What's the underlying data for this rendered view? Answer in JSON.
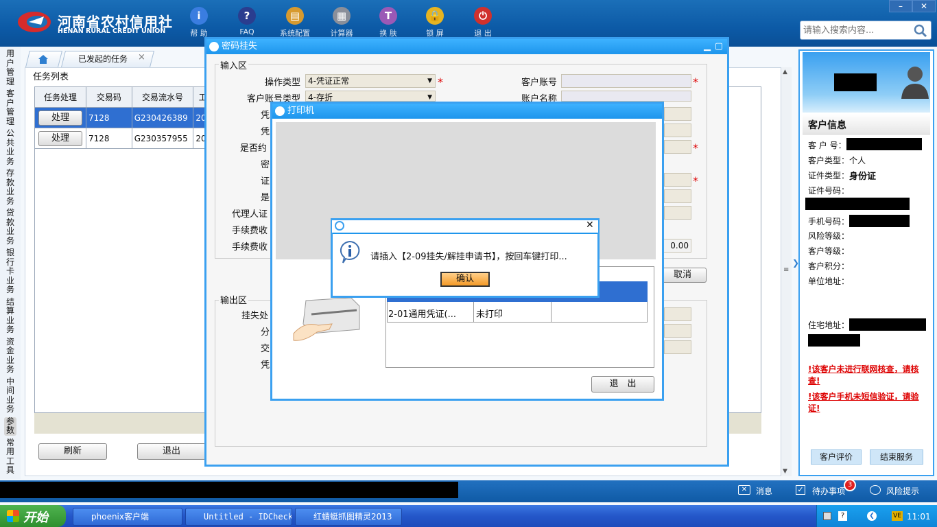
{
  "app": {
    "logo_cn": "河南省农村信用社",
    "logo_en": "HENAN RURAL CREDIT UNION",
    "nav": [
      {
        "label": "帮 助",
        "icon": "info-icon",
        "color": "#3a7de0"
      },
      {
        "label": "FAQ",
        "icon": "question-icon",
        "color": "#2a3d8f"
      },
      {
        "label": "系统配置",
        "icon": "toolbox-icon",
        "color": "#d79a2f"
      },
      {
        "label": "计算器",
        "icon": "calculator-icon",
        "color": "#8a8f9a"
      },
      {
        "label": "换 肤",
        "icon": "shirt-icon",
        "color": "#9b59b6"
      },
      {
        "label": "锁 屏",
        "icon": "lock-icon",
        "color": "#e6b422"
      },
      {
        "label": "退 出",
        "icon": "power-icon",
        "color": "#d0312d"
      }
    ],
    "search_placeholder": "请输入搜索内容...",
    "win_min": "–",
    "win_close": "✕"
  },
  "left_tabs": [
    "用户管理",
    "客户管理",
    "公共业务",
    "存款业务",
    "贷款业务",
    "银行卡业务",
    "结算业务",
    "资金业务",
    "中间业务",
    "参数",
    "常用工具"
  ],
  "tabs": {
    "home_icon": "home-icon",
    "active": "已发起的任务",
    "close": "×"
  },
  "task": {
    "title": "任务列表",
    "headers": [
      "任务处理",
      "交易码",
      "交易流水号",
      "工"
    ],
    "rows": [
      {
        "action": "处理",
        "code": "7128",
        "serial": "G230426389",
        "extra": "20"
      },
      {
        "action": "处理",
        "code": "7128",
        "serial": "G230357955",
        "extra": "20"
      }
    ],
    "refresh": "刷新",
    "exit": "退出"
  },
  "pwd_dialog": {
    "title": "密码挂失",
    "input_area": "输入区",
    "output_area": "输出区",
    "op_type_label": "操作类型",
    "op_type_value": "4-凭证正常",
    "acct_type_label": "客户账号类型",
    "acct_type_value": "4-存折",
    "cust_acct_label": "客户账号",
    "acct_name_label": "账户名称",
    "partial_labels": [
      "凭",
      "凭",
      "是否约",
      "密",
      "证",
      "是",
      "代理人证",
      "手续费收",
      "手续费收"
    ],
    "output_labels": [
      "挂失处",
      "分",
      "交",
      "凭"
    ],
    "fee_value": "0.00",
    "cancel": "取消"
  },
  "printer_dialog": {
    "title": "打印机",
    "table_row": [
      "2-01通用凭证(...",
      "未打印",
      ""
    ],
    "exit": "退　出"
  },
  "msgbox": {
    "message": "请插入【2-09挂失/解挂申请书】，按回车键打印...",
    "ok": "确认",
    "close": "✕"
  },
  "customer": {
    "title": "客户信息",
    "labels": {
      "no": "客 户 号：",
      "type": "客户类型：",
      "idtype": "证件类型：",
      "idno": "证件号码：",
      "phone": "手机号码：",
      "risk": "风险等级：",
      "level": "客户等级：",
      "points": "客户积分：",
      "work": "单位地址：",
      "home": "住宅地址："
    },
    "type_value": "个人",
    "idtype_value": "身份证",
    "warn1": "该客户未进行联网核查，请核查!",
    "warn2": "该客户手机未短信验证，请验证!",
    "eval_btn": "客户评价",
    "end_btn": "结束服务"
  },
  "bottombar": {
    "msg": "消息",
    "todo": "待办事项",
    "todo_count": "3",
    "risk": "风险提示"
  },
  "taskbar": {
    "start": "开始",
    "items": [
      "phoenix客户端",
      "Untitled - IDCheck",
      "红蜻蜓抓图精灵2013"
    ],
    "time": "11:01"
  }
}
